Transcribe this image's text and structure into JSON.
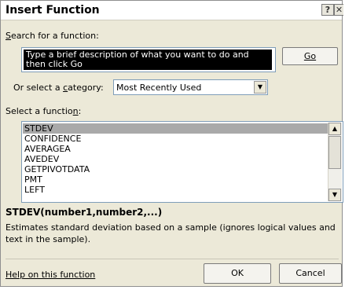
{
  "dialog": {
    "title": "Insert Function",
    "help_icon": "question-mark-icon",
    "close_icon": "close-icon"
  },
  "search": {
    "label_first": "S",
    "label_rest": "earch for a function:",
    "value": "Type a brief description of what you want to do and then click Go",
    "go_label": "Go"
  },
  "category": {
    "label_pre": "Or select a ",
    "label_u": "c",
    "label_post": "ategory:",
    "selected": "Most Recently Used"
  },
  "functions": {
    "label_pre": "Select a functio",
    "label_u": "n",
    "label_post": ":",
    "items": [
      "STDEV",
      "CONFIDENCE",
      "AVERAGEA",
      "AVEDEV",
      "GETPIVOTDATA",
      "PMT",
      "LEFT"
    ],
    "selected_index": 0
  },
  "details": {
    "syntax": "STDEV(number1,number2,...)",
    "description": "Estimates standard deviation based on a sample (ignores logical values and text in the sample)."
  },
  "footer": {
    "help_link": "Help on this function",
    "ok_label": "OK",
    "cancel_label": "Cancel"
  }
}
